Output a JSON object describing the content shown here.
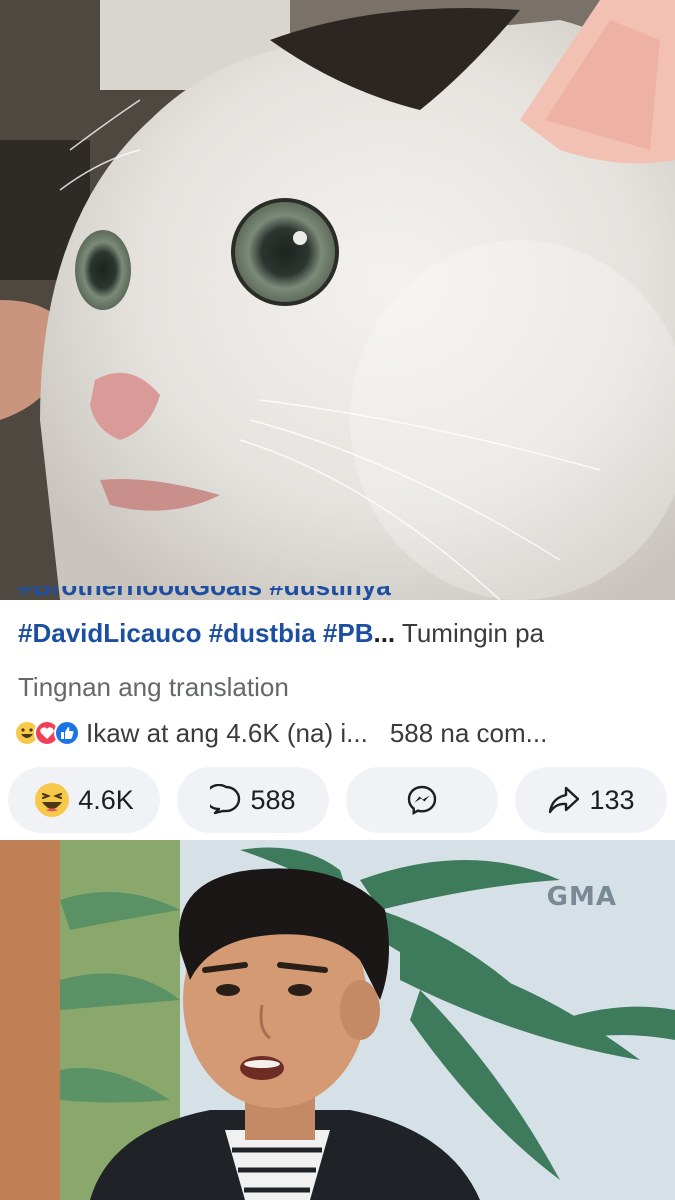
{
  "post": {
    "hashtags_clipped": "#BrotherhoodGoals #dustinya",
    "hashtag_line": {
      "tag1": "#DavidLicauco",
      "tag2": "#dustbia",
      "tag3": "#PB",
      "ellipsis": "...",
      "see_more": "Tumingin pa"
    },
    "translate_label": "Tingnan ang translation",
    "reaction_summary": {
      "reaction_icons": [
        "haha-icon",
        "love-icon",
        "like-icon"
      ],
      "likes_text": "Ikaw at ang 4.6K (na) i...",
      "comments_text": "588 na com..."
    }
  },
  "actions": {
    "react_count": "4.6K",
    "comment_count": "588",
    "share_count": "133"
  },
  "bottom_photo": {
    "watermark": "GMA"
  },
  "colors": {
    "hashtag": "#1c4fa1",
    "pill_bg": "#f0f2f5",
    "haha": "#f7c94a",
    "love": "#f33e58",
    "like": "#1b74e4"
  }
}
